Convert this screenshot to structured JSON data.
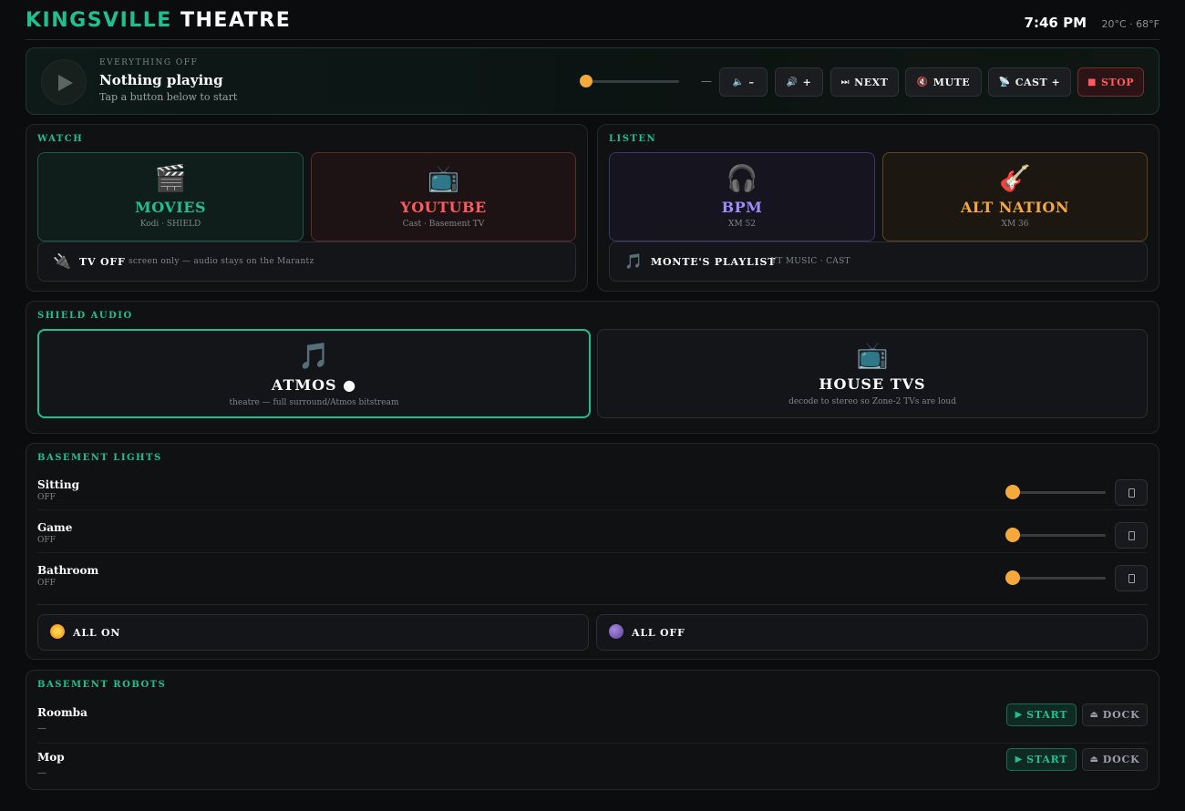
{
  "header": {
    "brand_part1": "KINGSVILLE",
    "brand_part2": "THEATRE",
    "time": "7:46 PM",
    "weather": "20°C · 68°F"
  },
  "now_playing": {
    "status": "EVERYTHING OFF",
    "title": "Nothing playing",
    "subtitle": "Tap a button below to start",
    "volume_value": "—",
    "volume_level": 0,
    "buttons": {
      "vol_down": "–",
      "vol_up": "+",
      "next": "NEXT",
      "mute": "MUTE",
      "cast": "CAST +",
      "stop": "STOP"
    }
  },
  "watch": {
    "title": "WATCH",
    "movies": {
      "icon": "clapper-icon",
      "label": "MOVIES",
      "sub": "Kodi · SHIELD",
      "color": "#1fc08f"
    },
    "youtube": {
      "icon": "tv-icon",
      "label": "YOUTUBE",
      "sub": "Cast · Basement TV",
      "color": "#ff5a5f"
    },
    "tv_off": {
      "icon": "plug-icon",
      "label": "TV OFF",
      "sub": "screen only — audio stays on the Marantz"
    }
  },
  "listen": {
    "title": "LISTEN",
    "bpm": {
      "icon": "headphones-icon",
      "label": "BPM",
      "sub": "XM 52",
      "color": "#9f8cff"
    },
    "alt_nation": {
      "icon": "guitar-icon",
      "label": "ALT NATION",
      "sub": "XM 36",
      "color": "#f4a93a"
    },
    "playlist": {
      "icon": "music-note-icon",
      "label": "MONTE'S PLAYLIST",
      "sub": "YT MUSIC · CAST"
    }
  },
  "shield_audio": {
    "title": "SHIELD AUDIO",
    "atmos": {
      "icon": "music-notes-icon",
      "label": "ATMOS ●",
      "sub": "theatre — full surround/Atmos bitstream",
      "selected": true
    },
    "house_tvs": {
      "icon": "tv-icon",
      "label": "HOUSE TVS",
      "sub": "decode to stereo so Zone-2 TVs are loud",
      "selected": false
    }
  },
  "lights": {
    "title": "BASEMENT LIGHTS",
    "items": [
      {
        "name": "Sitting",
        "state": "OFF",
        "level": 0
      },
      {
        "name": "Game",
        "state": "OFF",
        "level": 0
      },
      {
        "name": "Bathroom",
        "state": "OFF",
        "level": 0
      }
    ],
    "all_on": "ALL ON",
    "all_off": "ALL OFF"
  },
  "robots": {
    "title": "BASEMENT ROBOTS",
    "items": [
      {
        "name": "Roomba",
        "state": "—",
        "start": "START",
        "dock": "DOCK"
      },
      {
        "name": "Mop",
        "state": "—",
        "start": "START",
        "dock": "DOCK"
      }
    ]
  },
  "colors": {
    "accent": "#1fc08f",
    "warning": "#f4a93a",
    "danger": "#ff5a5f"
  }
}
